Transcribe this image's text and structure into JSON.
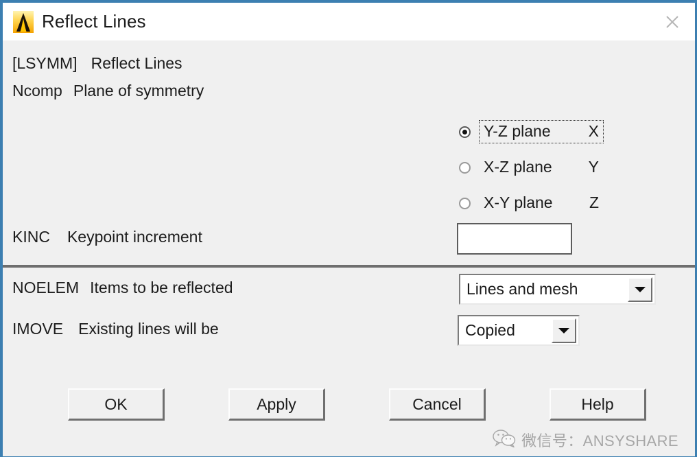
{
  "window": {
    "title": "Reflect Lines",
    "icon": "ansys-logo-icon",
    "close_icon": "close-icon",
    "accent_border_color": "#3c7fb1",
    "body_color": "#f0f0f0",
    "titlebar_color": "#ffffff"
  },
  "fields": {
    "lsymm": {
      "code": "[LSYMM]",
      "desc": "Reflect Lines"
    },
    "ncomp": {
      "code": "Ncomp",
      "desc": "Plane of symmetry"
    },
    "kinc": {
      "code": "KINC",
      "desc": "Keypoint increment",
      "value": "",
      "placeholder": ""
    },
    "noelem": {
      "code": "NOELEM",
      "desc": "Items to be reflected"
    },
    "imove": {
      "code": "IMOVE",
      "desc": "Existing lines will be"
    }
  },
  "radios": [
    {
      "label": "Y-Z plane",
      "axis": "X",
      "selected": true,
      "focused": true
    },
    {
      "label": "X-Z plane",
      "axis": "Y",
      "selected": false,
      "focused": false
    },
    {
      "label": "X-Y plane",
      "axis": "Z",
      "selected": false,
      "focused": false
    }
  ],
  "dropdowns": {
    "noelem": {
      "value": "Lines and mesh",
      "arrow_icon": "chevron-down-icon"
    },
    "imove": {
      "value": "Copied",
      "arrow_icon": "chevron-down-icon"
    }
  },
  "buttons": {
    "ok": "OK",
    "apply": "Apply",
    "cancel": "Cancel",
    "help": "Help"
  },
  "watermark": {
    "icon": "wechat-icon",
    "text": "微信号：ANSYSHARE"
  }
}
